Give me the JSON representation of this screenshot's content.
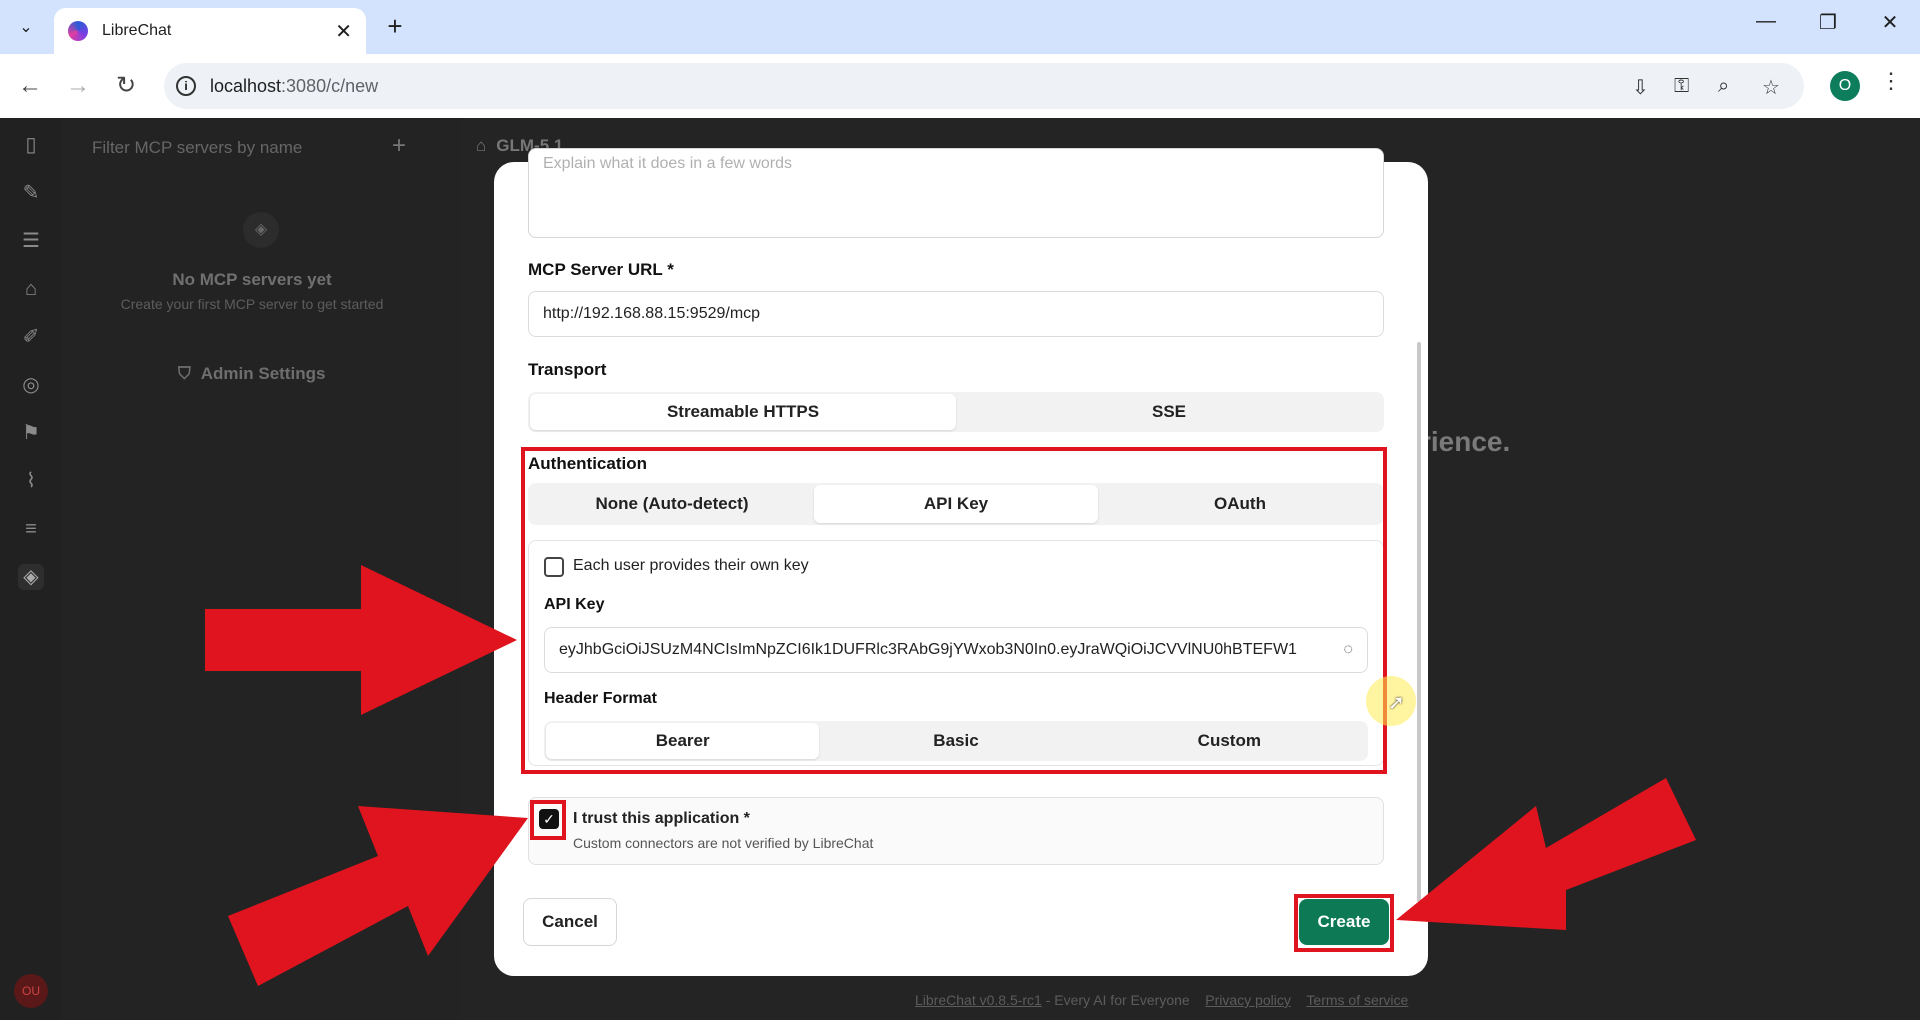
{
  "browser": {
    "tab_title": "LibreChat",
    "url_host": "localhost",
    "url_path": ":3080/c/new",
    "profile_initial": "O"
  },
  "sidebar": {
    "filter_placeholder": "Filter MCP servers by name",
    "empty_title": "No MCP servers yet",
    "empty_subtitle": "Create your first MCP server to get started",
    "admin_settings": "Admin Settings",
    "avatar_initials": "OU"
  },
  "main": {
    "model_name": "GLM-5.1",
    "background_text": "rience.",
    "footer_link": "LibreChat v0.8.5-rc1",
    "footer_tagline": " - Every AI for Everyone",
    "footer_privacy": "Privacy policy",
    "footer_terms": "Terms of service"
  },
  "modal": {
    "description_placeholder": "Explain what it does in a few words",
    "url_label": "MCP Server URL *",
    "url_value": "http://192.168.88.15:9529/mcp",
    "transport_label": "Transport",
    "transport_options": [
      "Streamable HTTPS",
      "SSE"
    ],
    "transport_selected": "Streamable HTTPS",
    "auth_label": "Authentication",
    "auth_options": [
      "None (Auto-detect)",
      "API Key",
      "OAuth"
    ],
    "auth_selected": "API Key",
    "own_key_label": "Each user provides their own key",
    "api_key_label": "API Key",
    "api_key_value": "eyJhbGciOiJSUzM4NCIsImNpZCI6Ik1DUFRlc3RAbG9jYWxob3N0In0.eyJraWQiOiJCVVlNU0hBTEFW1",
    "header_format_label": "Header Format",
    "header_format_options": [
      "Bearer",
      "Basic",
      "Custom"
    ],
    "header_format_selected": "Bearer",
    "trust_label": "I trust this application *",
    "trust_sublabel": "Custom connectors are not verified by LibreChat",
    "cancel_label": "Cancel",
    "create_label": "Create"
  },
  "colors": {
    "accent": "#0e7a55",
    "annotation_red": "#e0141e",
    "chrome_blue": "#d3e3fd"
  }
}
